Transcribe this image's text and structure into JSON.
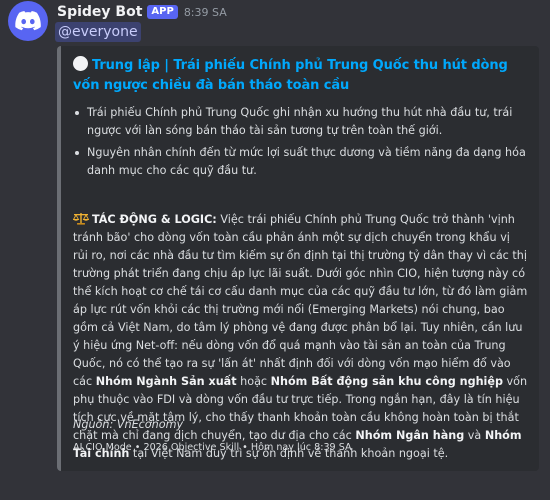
{
  "bot": {
    "name": "Spidey Bot",
    "badge": "APP",
    "timestamp": "8:39 SA",
    "avatar_icon": "discord-logo-icon",
    "avatar_color": "#5865f2"
  },
  "mention": "@everyone",
  "embed": {
    "title_icon": "white-circle-icon",
    "title": "Trung lập | Trái phiếu Chính phủ Trung Quốc thu hút dòng vốn ngược chiều đà bán tháo toàn cầu",
    "bullets": [
      "Trái phiếu Chính phủ Trung Quốc ghi nhận xu hướng thu hút nhà đầu tư, trái ngược với làn sóng bán tháo tài sản tương tự trên toàn thế giới.",
      "Nguyên nhân chính đến từ mức lợi suất thực dương và tiềm năng đa dạng hóa danh mục cho các quỹ đầu tư."
    ],
    "impact": {
      "icon": "balance-scale-icon",
      "heading": "TÁC ĐỘNG & LOGIC:",
      "text_1": " Việc trái phiếu Chính phủ Trung Quốc trở thành 'vịnh tránh bão' cho dòng vốn toàn cầu phản ánh một sự dịch chuyển trong khẩu vị rủi ro, nơi các nhà đầu tư tìm kiếm sự ổn định tại thị trường tỷ dân thay vì các thị trường phát triển đang chịu áp lực lãi suất. Dưới góc nhìn CIO, hiện tượng này có thể kích hoạt cơ chế tái cơ cấu danh mục của các quỹ đầu tư lớn, từ đó làm giảm áp lực rút vốn khỏi các thị trường mới nổi (Emerging Markets) nói chung, bao gồm cả Việt Nam, do tâm lý phòng vệ đang được phân bổ lại. Tuy nhiên, cần lưu ý hiệu ứng Net-off: nếu dòng vốn đổ quá mạnh vào tài sản an toàn của Trung Quốc, nó có thể tạo ra sự 'lấn át' nhất định đối với dòng vốn mạo hiểm đổ vào các ",
      "bold_1": "Nhóm Ngành Sản xuất",
      "text_2": " hoặc ",
      "bold_2": "Nhóm Bất động sản khu công nghiệp",
      "text_3": " vốn phụ thuộc vào FDI và dòng vốn đầu tư trực tiếp. Trong ngắn hạn, đây là tín hiệu tích cực về mặt tâm lý, cho thấy thanh khoản toàn cầu không hoàn toàn bị thắt chặt mà chỉ đang dịch chuyển, tạo dư địa cho các ",
      "bold_3": "Nhóm Ngân hàng",
      "text_4": " và ",
      "bold_4": "Nhóm Tài chính",
      "text_5": " tại Việt Nam duy trì sự ổn định về thanh khoản ngoại tệ."
    },
    "source": "Nguồn: VnEconomy",
    "footer": "AI CIO Mode • 2026 Objective Skill • Hôm nay lúc 8:39 SA",
    "border_color": "#6b6e74",
    "title_color": "#00a8fc"
  }
}
